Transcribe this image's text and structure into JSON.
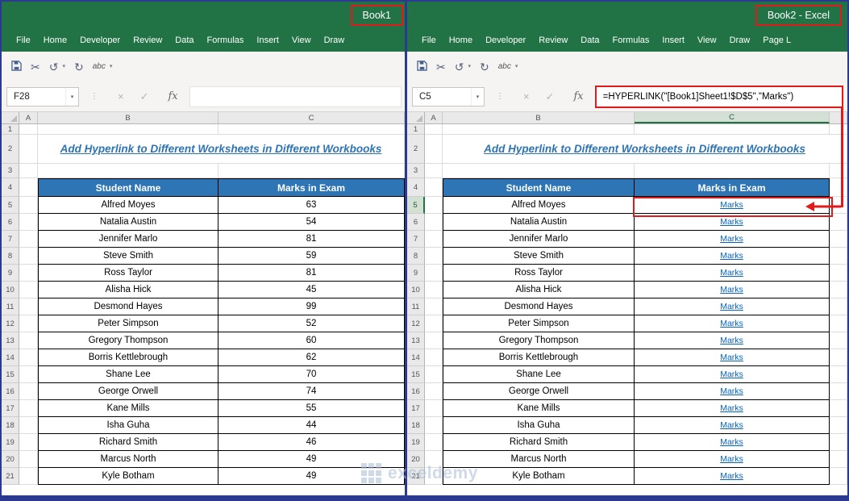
{
  "colors": {
    "excel_green": "#217346",
    "table_header_blue": "#2e75b6",
    "sheet_title_blue": "#2e74b5",
    "hyperlink_blue": "#0563c1",
    "annotation_red": "#e11b1b",
    "window_frame_navy": "#2b3990"
  },
  "icons": {
    "save": "floppy-disk",
    "cut": "✂",
    "undo": "↺",
    "redo": "↻",
    "spelling": "abc",
    "dropdown": "▾",
    "separator_dots": "⋮",
    "cancel": "×",
    "enter": "✓",
    "insert_function": "fx"
  },
  "sheet_title": "Add Hyperlink to Different Worksheets in Different Workbooks",
  "table_headers": [
    "Student Name",
    "Marks in Exam"
  ],
  "students": [
    "Alfred Moyes",
    "Natalia Austin",
    "Jennifer Marlo",
    "Steve Smith",
    "Ross Taylor",
    "Alisha Hick",
    "Desmond Hayes",
    "Peter Simpson",
    "Gregory Thompson",
    "Borris Kettlebrough",
    "Shane Lee",
    "George Orwell",
    "Kane Mills",
    "Isha Guha",
    "Richard Smith",
    "Marcus North",
    "Kyle Botham"
  ],
  "marks": [
    63,
    54,
    81,
    59,
    81,
    45,
    99,
    52,
    60,
    62,
    70,
    74,
    55,
    44,
    46,
    49,
    49
  ],
  "link_text": "Marks",
  "grid": {
    "row_count": 21,
    "columns": [
      "A",
      "B",
      "C"
    ]
  },
  "left_window": {
    "title": "Book1",
    "tabs": [
      "File",
      "Home",
      "Developer",
      "Review",
      "Data",
      "Formulas",
      "Insert",
      "View",
      "Draw"
    ],
    "name_box": "F28",
    "formula": ""
  },
  "right_window": {
    "title": "Book2  -  Excel",
    "tabs": [
      "File",
      "Home",
      "Developer",
      "Review",
      "Data",
      "Formulas",
      "Insert",
      "View",
      "Draw",
      "Page L"
    ],
    "name_box": "C5",
    "formula": "=HYPERLINK(\"[Book1]Sheet1!$D$5\",\"Marks\")",
    "active_cell": "C5"
  },
  "watermark": {
    "text": "exceldemy"
  }
}
